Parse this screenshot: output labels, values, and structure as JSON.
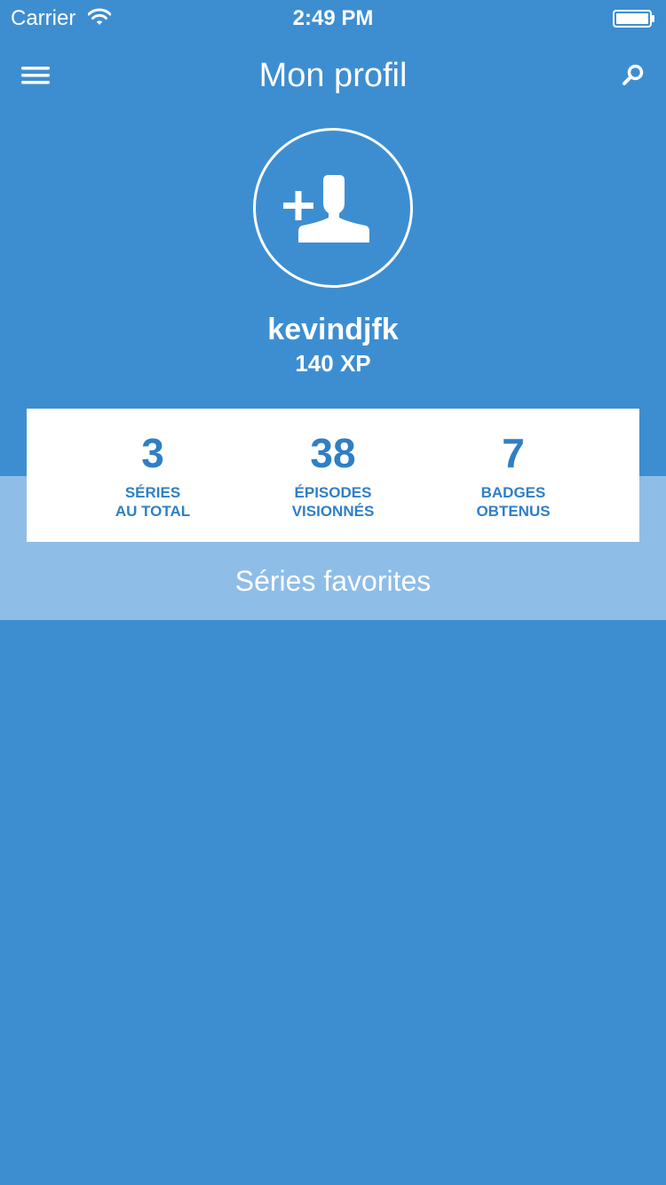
{
  "status_bar": {
    "carrier": "Carrier",
    "time": "2:49 PM",
    "wifi_icon": "wifi-icon",
    "battery_icon": "battery-icon"
  },
  "nav": {
    "title": "Mon profil",
    "menu_icon": "hamburger-menu-icon",
    "search_icon": "search-icon"
  },
  "profile": {
    "avatar_icon": "add-user-icon",
    "username": "kevindjfk",
    "xp": "140 XP"
  },
  "stats": [
    {
      "value": "3",
      "line1": "SÉRIES",
      "line2": "AU TOTAL"
    },
    {
      "value": "38",
      "line1": "ÉPISODES",
      "line2": "VISIONNÉS"
    },
    {
      "value": "7",
      "line1": "BADGES",
      "line2": "OBTENUS"
    }
  ],
  "favorites": {
    "label": "Séries favorites"
  },
  "colors": {
    "background": "#3d8ed1",
    "band": "#8ebde8",
    "stat_text": "#2f7fc6",
    "card": "#ffffff"
  }
}
